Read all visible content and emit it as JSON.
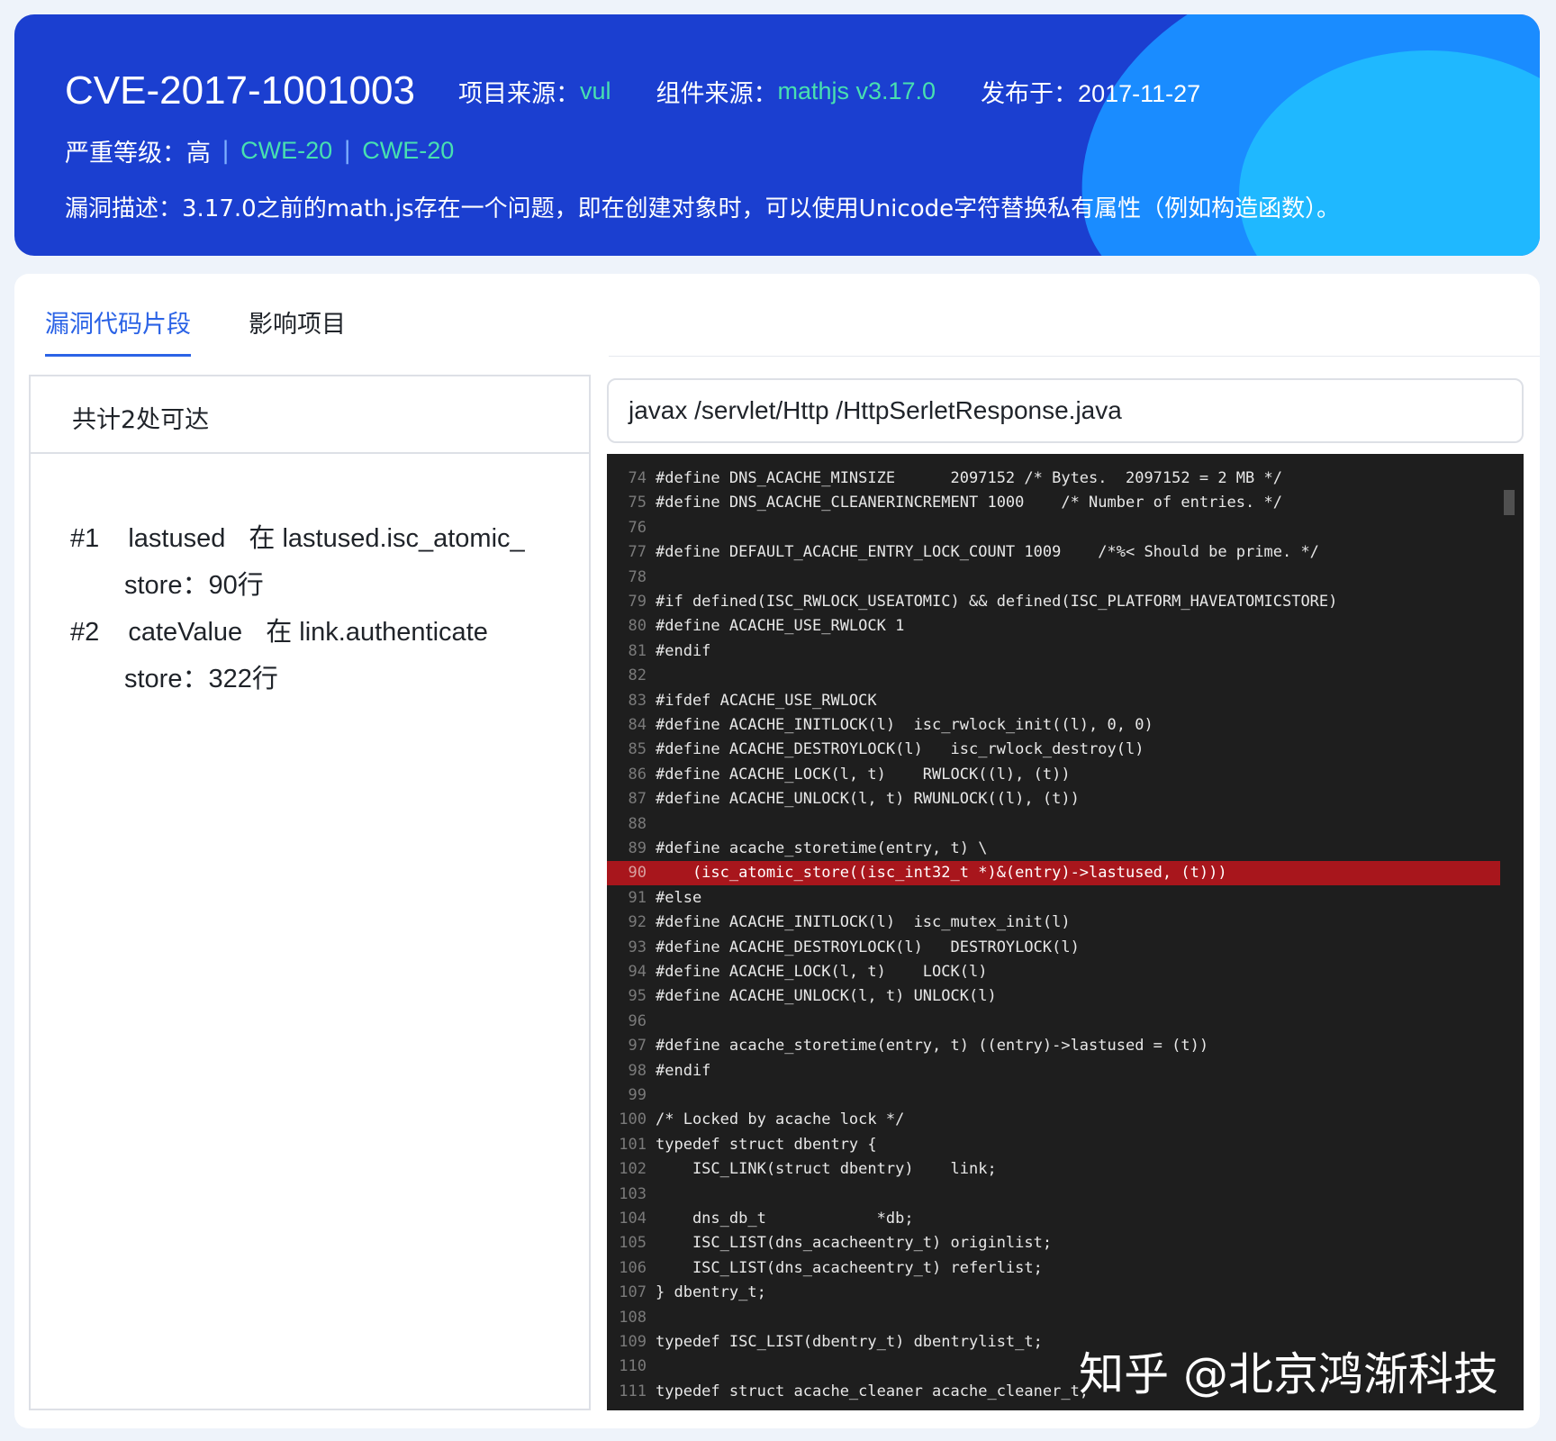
{
  "header": {
    "cve_id": "CVE-2017-1001003",
    "project_source_label": "项目来源：",
    "project_source_value": "vul",
    "component_source_label": "组件来源：",
    "component_source_value": "mathjs v3.17.0",
    "published": "发布于：2017-11-27",
    "severity_label": "严重等级：高",
    "separator": "|",
    "cwe": [
      "CWE-20",
      "CWE-20"
    ],
    "description": "漏洞描述：3.17.0之前的math.js存在一个问题，即在创建对象时，可以使用Unicode字符替换私有属性（例如构造函数）。",
    "accent_color": "#48e0b0",
    "background_color": "#1b3fd0"
  },
  "tabs": [
    {
      "label": "漏洞代码片段",
      "active": true
    },
    {
      "label": "影响项目",
      "active": false
    }
  ],
  "reach": {
    "title": "共计2处可达",
    "items": [
      {
        "num": "#1",
        "variable": "lastused",
        "location": "在 lastused.isc_atomic_",
        "detail": "store：90行"
      },
      {
        "num": "#2",
        "variable": "cateValue",
        "location": "在 link.authenticate",
        "detail": "store：322行"
      }
    ]
  },
  "file_path": "javax /servlet/Http /HttpSerletResponse.java",
  "code": {
    "highlight_line": "90",
    "lines": [
      {
        "n": "74",
        "text": "#define DNS_ACACHE_MINSIZE      2097152 /* Bytes.  2097152 = 2 MB */"
      },
      {
        "n": "75",
        "text": "#define DNS_ACACHE_CLEANERINCREMENT 1000    /* Number of entries. */"
      },
      {
        "n": "76",
        "text": ""
      },
      {
        "n": "77",
        "text": "#define DEFAULT_ACACHE_ENTRY_LOCK_COUNT 1009    /*%< Should be prime. */"
      },
      {
        "n": "78",
        "text": ""
      },
      {
        "n": "79",
        "text": "#if defined(ISC_RWLOCK_USEATOMIC) && defined(ISC_PLATFORM_HAVEATOMICSTORE)"
      },
      {
        "n": "80",
        "text": "#define ACACHE_USE_RWLOCK 1"
      },
      {
        "n": "81",
        "text": "#endif"
      },
      {
        "n": "82",
        "text": ""
      },
      {
        "n": "83",
        "text": "#ifdef ACACHE_USE_RWLOCK"
      },
      {
        "n": "84",
        "text": "#define ACACHE_INITLOCK(l)  isc_rwlock_init((l), 0, 0)"
      },
      {
        "n": "85",
        "text": "#define ACACHE_DESTROYLOCK(l)   isc_rwlock_destroy(l)"
      },
      {
        "n": "86",
        "text": "#define ACACHE_LOCK(l, t)    RWLOCK((l), (t))"
      },
      {
        "n": "87",
        "text": "#define ACACHE_UNLOCK(l, t) RWUNLOCK((l), (t))"
      },
      {
        "n": "88",
        "text": ""
      },
      {
        "n": "89",
        "text": "#define acache_storetime(entry, t) \\"
      },
      {
        "n": "90",
        "text": "    (isc_atomic_store((isc_int32_t *)&(entry)->lastused, (t)))"
      },
      {
        "n": "91",
        "text": "#else"
      },
      {
        "n": "92",
        "text": "#define ACACHE_INITLOCK(l)  isc_mutex_init(l)"
      },
      {
        "n": "93",
        "text": "#define ACACHE_DESTROYLOCK(l)   DESTROYLOCK(l)"
      },
      {
        "n": "94",
        "text": "#define ACACHE_LOCK(l, t)    LOCK(l)"
      },
      {
        "n": "95",
        "text": "#define ACACHE_UNLOCK(l, t) UNLOCK(l)"
      },
      {
        "n": "96",
        "text": ""
      },
      {
        "n": "97",
        "text": "#define acache_storetime(entry, t) ((entry)->lastused = (t))"
      },
      {
        "n": "98",
        "text": "#endif"
      },
      {
        "n": "99",
        "text": ""
      },
      {
        "n": "100",
        "text": "/* Locked by acache lock */"
      },
      {
        "n": "101",
        "text": "typedef struct dbentry {"
      },
      {
        "n": "102",
        "text": "    ISC_LINK(struct dbentry)    link;"
      },
      {
        "n": "103",
        "text": ""
      },
      {
        "n": "104",
        "text": "    dns_db_t            *db;"
      },
      {
        "n": "105",
        "text": "    ISC_LIST(dns_acacheentry_t) originlist;"
      },
      {
        "n": "106",
        "text": "    ISC_LIST(dns_acacheentry_t) referlist;"
      },
      {
        "n": "107",
        "text": "} dbentry_t;"
      },
      {
        "n": "108",
        "text": ""
      },
      {
        "n": "109",
        "text": "typedef ISC_LIST(dbentry_t) dbentrylist_t;"
      },
      {
        "n": "110",
        "text": ""
      },
      {
        "n": "111",
        "text": "typedef struct acache_cleaner acache_cleaner_t;"
      }
    ]
  },
  "watermark": "知乎 @北京鸿渐科技"
}
